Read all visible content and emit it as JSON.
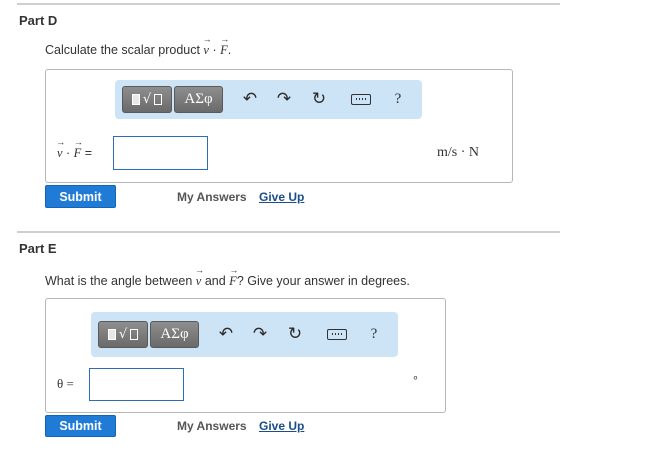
{
  "part_d": {
    "title": "Part D",
    "question_prefix": "Calculate the scalar product ",
    "vec_v": "v",
    "dot": " · ",
    "vec_f": "F",
    "question_suffix": ".",
    "answer_eq": " =",
    "unit": "m/s · N",
    "submit_label": "Submit",
    "my_answers_label": "My Answers",
    "give_up_label": "Give Up"
  },
  "part_e": {
    "title": "Part E",
    "question_prefix": "What is the angle between ",
    "vec_v": "v",
    "question_mid": " and ",
    "vec_f": "F",
    "question_suffix": "? Give your answer in degrees.",
    "answer_label": "θ =",
    "unit": "∘",
    "submit_label": "Submit",
    "my_answers_label": "My Answers",
    "give_up_label": "Give Up"
  },
  "toolbar": {
    "greek_label": "ΑΣφ",
    "help_label": "?",
    "icons": [
      "templates-icon",
      "greek-letters-icon",
      "undo-icon",
      "redo-icon",
      "reset-icon",
      "keyboard-icon",
      "help-icon"
    ]
  },
  "colors": {
    "accent": "#1f7bd6",
    "toolbar_bg": "#cde3f6",
    "link": "#1a4d8a"
  }
}
